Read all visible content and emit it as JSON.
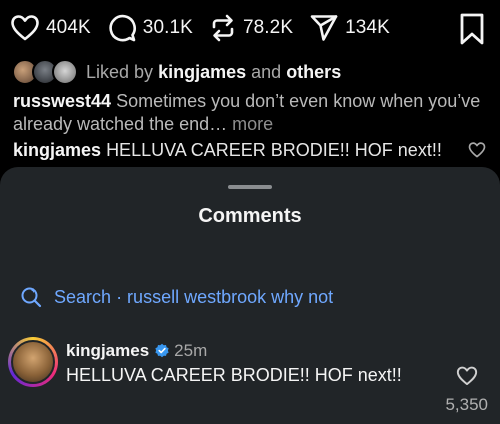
{
  "actions": {
    "likes": "404K",
    "comments": "30.1K",
    "reposts": "78.2K",
    "shares": "134K"
  },
  "liked_by": {
    "prefix": "Liked by",
    "user": "kingjames",
    "joiner": "and",
    "others": "others"
  },
  "caption": {
    "username": "russwest44",
    "text": "Sometimes you don’t even know when you’ve already watched the end…",
    "more": "more"
  },
  "preview_comment": {
    "username": "kingjames",
    "text": "HELLUVA CAREER BRODIE!! HOF next!!"
  },
  "sheet": {
    "title": "Comments",
    "search_label": "Search",
    "search_query": "· russell westbrook why not"
  },
  "comment": {
    "username": "kingjames",
    "time": "25m",
    "text": "HELLUVA CAREER BRODIE!! HOF next!!",
    "likes": "5,350"
  },
  "colors": {
    "background": "#000000",
    "sheet": "#212528",
    "link_blue": "#6fa8ff",
    "verified_blue": "#3897f0"
  },
  "icons": [
    "heart-icon",
    "comment-icon",
    "repost-icon",
    "share-icon",
    "bookmark-icon",
    "search-icon",
    "verified-icon"
  ]
}
